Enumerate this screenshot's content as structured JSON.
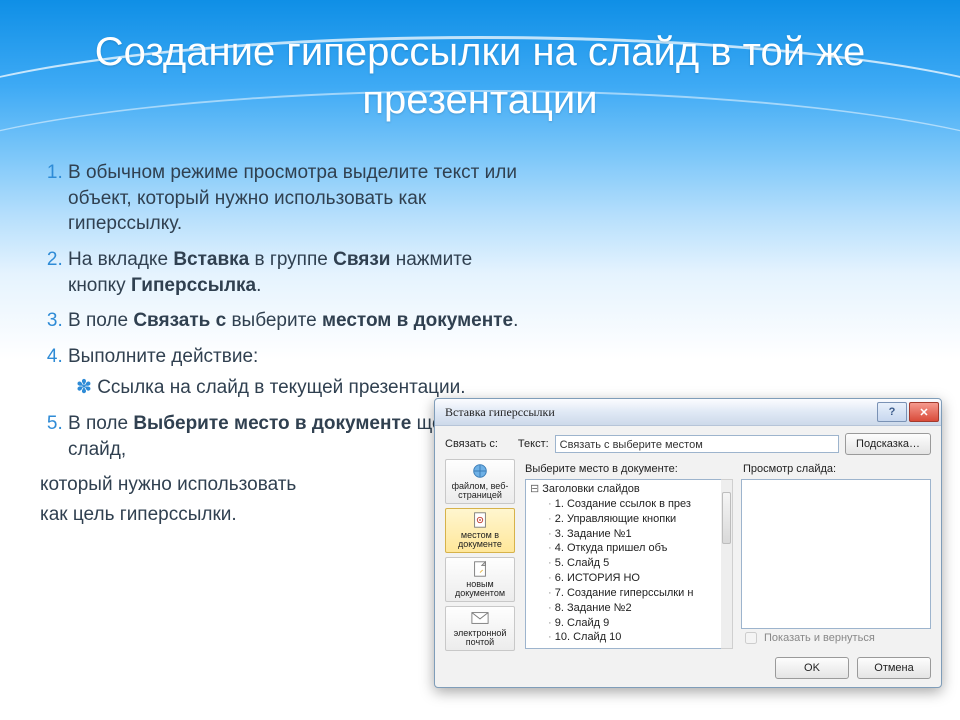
{
  "title": "Создание гиперссылки на слайд в той же презентации",
  "list": {
    "i1": "В обычном режиме просмотра выделите текст или объект, который нужно использовать как гиперссылку.",
    "i2_a": "На вкладке ",
    "i2_b": "Вставка",
    "i2_c": " в группе ",
    "i2_d": "Связи",
    "i2_e": " нажмите кнопку ",
    "i2_f": "Гиперссылка",
    "i2_g": ".",
    "i3_a": "В поле ",
    "i3_b": "Связать с",
    "i3_c": " выберите ",
    "i3_d": "местом в документе",
    "i3_e": ".",
    "i4": "Выполните действие:",
    "i4_sub": "Ссылка на слайд в текущей презентации.",
    "i5_a": "В поле ",
    "i5_b": "Выберите место в документе",
    "i5_c": " щелкните слайд,",
    "tail1": "который нужно использовать",
    "tail2": "как цель гиперссылки."
  },
  "dialog": {
    "title": "Вставка гиперссылки",
    "link_to_label": "Связать с:",
    "text_label": "Текст:",
    "text_value": "Связать с выберите местом",
    "hint_btn": "Подсказка…",
    "link_col": {
      "a": "файлом, веб-страницей",
      "b": "местом в документе",
      "c": "новым документом",
      "d": "электронной почтой"
    },
    "select_label": "Выберите место в документе:",
    "preview_label": "Просмотр слайда:",
    "tree_root": "Заголовки слайдов",
    "tree": [
      "1. Создание ссылок в през",
      "2. Управляющие кнопки",
      "3. Задание №1",
      "4. Откуда пришел       объ",
      "5. Слайд 5",
      "6.          ИСТОРИЯ    НО",
      "7. Создание гиперссылки н",
      "8. Задание №2",
      "9. Слайд 9",
      "10. Слайд 10"
    ],
    "checkbox": "Показать и вернуться",
    "ok": "OK",
    "cancel": "Отмена",
    "help": "?",
    "close": "✕"
  }
}
